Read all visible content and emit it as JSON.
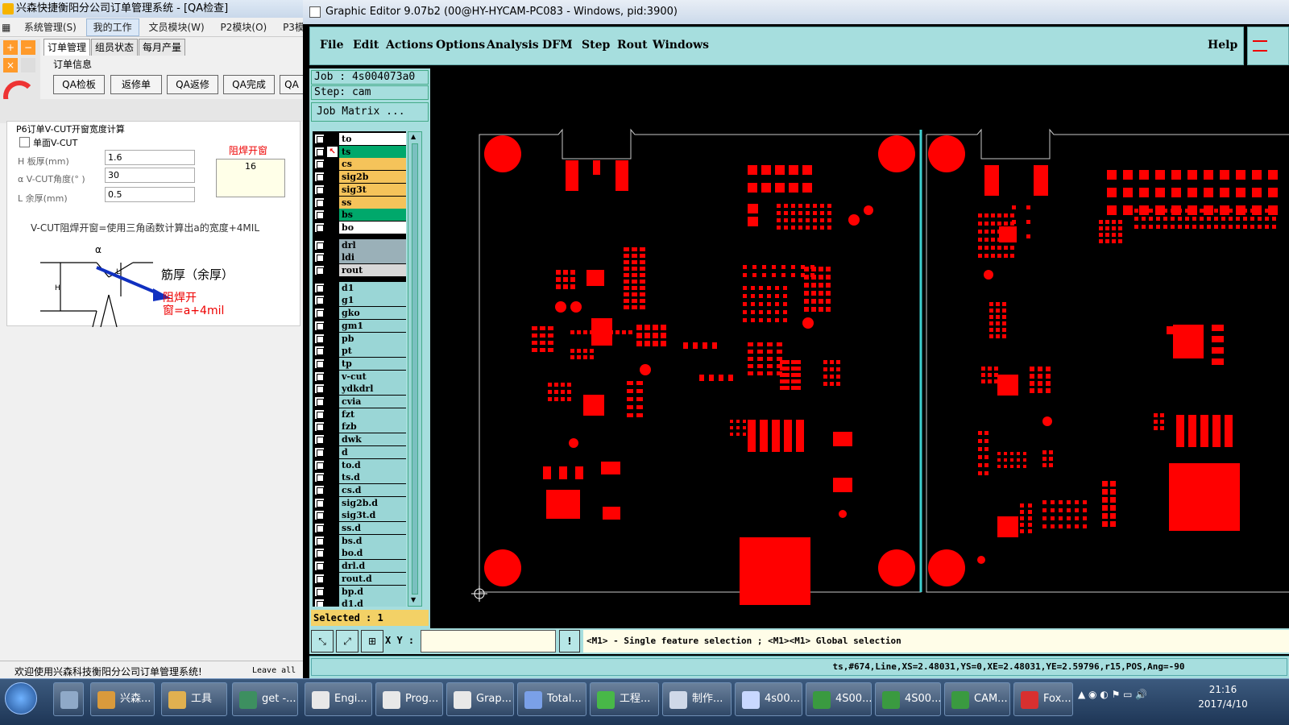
{
  "left_app": {
    "title": "兴森快捷衡阳分公司订单管理系统 - [QA检查]",
    "menu": [
      "系统管理(S)",
      "我的工作",
      "文员模块(W)",
      "P2模块(O)",
      "P3模块"
    ],
    "tabs": [
      "订单管理",
      "组员状态",
      "每月产量"
    ],
    "section_label": "订单信息",
    "buttons": [
      "QA检板",
      "返修单",
      "QA返修",
      "QA完成",
      "QA"
    ],
    "vcut_title": "P6订单V-CUT开窗宽度计算",
    "single_vcut_label": "单面V-CUT",
    "fields": [
      {
        "label": "H 板厚(mm)",
        "value": "1.6"
      },
      {
        "label": "α V-CUT角度(° )",
        "value": "30"
      },
      {
        "label": "L 余厚(mm)",
        "value": "0.5"
      }
    ],
    "result_label": "阻焊开窗",
    "result_value": "16",
    "formula_text": "V-CUT阻焊开窗=使用三角函数计算出a的宽度+4MIL",
    "diagram_text_1": "筋厚（余厚）",
    "diagram_text_2": "阻焊开",
    "diagram_text_3": "窗=a+4mil",
    "diagram_labels": [
      "α",
      "L",
      "H"
    ],
    "welcome": "欢迎使用兴森科技衡阳分公司订单管理系统!",
    "leave_all": "Leave all"
  },
  "editor": {
    "title": "Graphic Editor 9.07b2 (00@HY-HYCAM-PC083 - Windows, pid:3900)",
    "menu": [
      "File",
      "Edit",
      "Actions",
      "Options",
      "Analysis",
      "DFM",
      "Step",
      "Rout",
      "Windows"
    ],
    "help": "Help",
    "job": "Job : 4s004073a0",
    "step": "Step: cam",
    "job_matrix": "Job Matrix ...",
    "layers": [
      {
        "name": "to",
        "color": "#ffffff"
      },
      {
        "name": "ts",
        "color": "#00a86b"
      },
      {
        "name": "cs",
        "color": "#f5c35a"
      },
      {
        "name": "sig2b",
        "color": "#f5c35a"
      },
      {
        "name": "sig3t",
        "color": "#f5c35a"
      },
      {
        "name": "ss",
        "color": "#f5c35a"
      },
      {
        "name": "bs",
        "color": "#00a86b"
      },
      {
        "name": "bo",
        "color": "#ffffff"
      },
      {
        "name": "drl",
        "color": "#9ab0b8"
      },
      {
        "name": "ldi",
        "color": "#9ab0b8"
      },
      {
        "name": "rout",
        "color": "#d8d8d8"
      },
      {
        "name": "d1",
        "color": "#9ad6d6"
      },
      {
        "name": "g1",
        "color": "#9ad6d6"
      },
      {
        "name": "gko",
        "color": "#9ad6d6"
      },
      {
        "name": "gm1",
        "color": "#9ad6d6"
      },
      {
        "name": "pb",
        "color": "#9ad6d6"
      },
      {
        "name": "pt",
        "color": "#9ad6d6"
      },
      {
        "name": "tp",
        "color": "#9ad6d6"
      },
      {
        "name": "v-cut",
        "color": "#9ad6d6"
      },
      {
        "name": "ydkdrl",
        "color": "#9ad6d6"
      },
      {
        "name": "cvia",
        "color": "#9ad6d6"
      },
      {
        "name": "fzt",
        "color": "#9ad6d6"
      },
      {
        "name": "fzb",
        "color": "#9ad6d6"
      },
      {
        "name": "dwk",
        "color": "#9ad6d6"
      },
      {
        "name": "d",
        "color": "#9ad6d6"
      },
      {
        "name": "to.d",
        "color": "#9ad6d6"
      },
      {
        "name": "ts.d",
        "color": "#9ad6d6"
      },
      {
        "name": "cs.d",
        "color": "#9ad6d6"
      },
      {
        "name": "sig2b.d",
        "color": "#9ad6d6"
      },
      {
        "name": "sig3t.d",
        "color": "#9ad6d6"
      },
      {
        "name": "ss.d",
        "color": "#9ad6d6"
      },
      {
        "name": "bs.d",
        "color": "#9ad6d6"
      },
      {
        "name": "bo.d",
        "color": "#9ad6d6"
      },
      {
        "name": "drl.d",
        "color": "#9ad6d6"
      },
      {
        "name": "rout.d",
        "color": "#9ad6d6"
      },
      {
        "name": "bp.d",
        "color": "#9ad6d6"
      },
      {
        "name": "d1.d",
        "color": "#9ad6d6"
      }
    ],
    "selected": "Selected : 1",
    "xy_label": "X Y :",
    "hint": "<M1> - Single feature selection ; <M1><M1> Global selection",
    "status": "ts,#674,Line,XS=2.48031,YS=0,XE=2.48031,YE=2.59796,r15,POS,Ang=-90",
    "accent": "#ff0000",
    "cyan": "#3fd0d0"
  },
  "taskbar": {
    "items": [
      "兴森...",
      "工具",
      "get -...",
      "Engi...",
      "Prog...",
      "Grap...",
      "Total...",
      "工程...",
      "制作...",
      "4s00...",
      "4S00...",
      "4S00...",
      "CAM...",
      "Fox..."
    ],
    "time": "21:16",
    "date": "2017/4/10"
  }
}
